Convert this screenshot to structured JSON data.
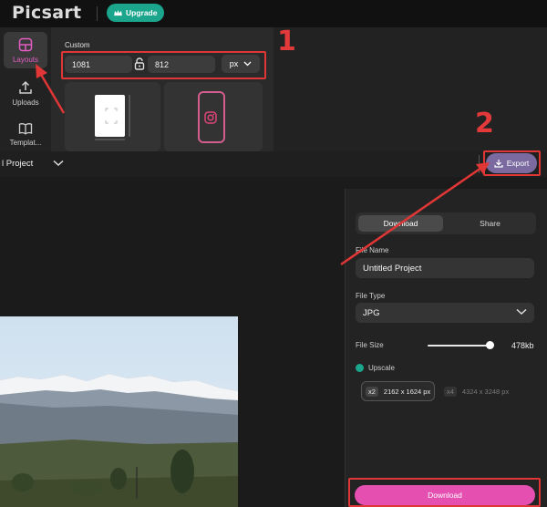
{
  "app": {
    "logo_text": "Picsart",
    "upgrade_label": "Upgrade",
    "accent_color": "#e44fb0",
    "upgrade_color": "#1aa58c"
  },
  "sidebar": {
    "items": [
      {
        "label": "Layouts",
        "icon": "layout-icon",
        "active": true
      },
      {
        "label": "Uploads",
        "icon": "upload-icon",
        "active": false
      },
      {
        "label": "Templat...",
        "icon": "book-icon",
        "active": false
      }
    ]
  },
  "layout_panel": {
    "custom_label": "Custom",
    "width_value": "1081",
    "height_value": "812",
    "unit": "px",
    "templates": [
      {
        "icon": "square-canvas-icon"
      },
      {
        "icon": "instagram-icon"
      }
    ]
  },
  "project_bar": {
    "project_name": "l Project",
    "export_label": "Export"
  },
  "export_panel": {
    "tabs": [
      {
        "label": "Download",
        "active": true
      },
      {
        "label": "Share",
        "active": false
      }
    ],
    "file_name_label": "File Name",
    "file_name_value": "Untitled Project",
    "file_type_label": "File Type",
    "file_type_value": "JPG",
    "file_size_label": "File Size",
    "file_size_value": "478kb",
    "file_size_slider": 0.92,
    "upscale_label": "Upscale",
    "upscale_options": [
      {
        "mult": "x2",
        "size": "2162 x 1624 px",
        "selected": true
      },
      {
        "mult": "x4",
        "size": "4324 x 3248 px",
        "selected": false
      }
    ],
    "download_label": "Download"
  },
  "annotations": {
    "step_1": "1",
    "step_2": "2",
    "highlight_color": "#e03636"
  }
}
